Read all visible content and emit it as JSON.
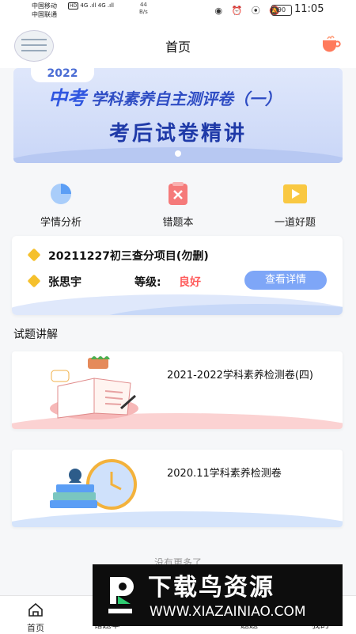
{
  "status_bar": {
    "carrier1": "中国移动",
    "carrier2": "中国联通",
    "hd": "HD",
    "signal": "4G .ıll 4G .ıll",
    "speed_value": "44",
    "speed_unit": "B/s",
    "icons": "◉ ⏰ ⦿ 🔕",
    "battery": "90",
    "time": "11:05"
  },
  "header": {
    "title": "首页"
  },
  "banner": {
    "year": "2022",
    "line1_big": "中考",
    "line1_rest": "学科素养自主测评卷（一）",
    "line2": "考后试卷精讲"
  },
  "quick_menu": [
    {
      "label": "学情分析",
      "icon": "pie-chart-icon"
    },
    {
      "label": "错题本",
      "icon": "wrong-book-icon"
    },
    {
      "label": "一道好题",
      "icon": "video-icon"
    }
  ],
  "score_card": {
    "project": "20211227初三查分项目(勿删)",
    "student": "张思宇",
    "grade_label": "等级:",
    "grade_value": "良好",
    "detail_button": "查看详情"
  },
  "section_title": "试题讲解",
  "papers": [
    {
      "title": "2021-2022学科素养检测卷(四)"
    },
    {
      "title": "2020.11学科素养检测卷"
    }
  ],
  "no_more": "没有更多了",
  "tabbar": {
    "items": [
      {
        "label": "首页"
      },
      {
        "label": "错题本"
      },
      {
        "label": "题题"
      },
      {
        "label": "我的"
      }
    ]
  },
  "watermark": {
    "title": "下载鸟资源",
    "url": "WWW.XIAZAINIAO.COM"
  },
  "colors": {
    "accent": "#7ea6f7",
    "grade": "#ff5c5c",
    "banner": "#c9d6f7"
  }
}
